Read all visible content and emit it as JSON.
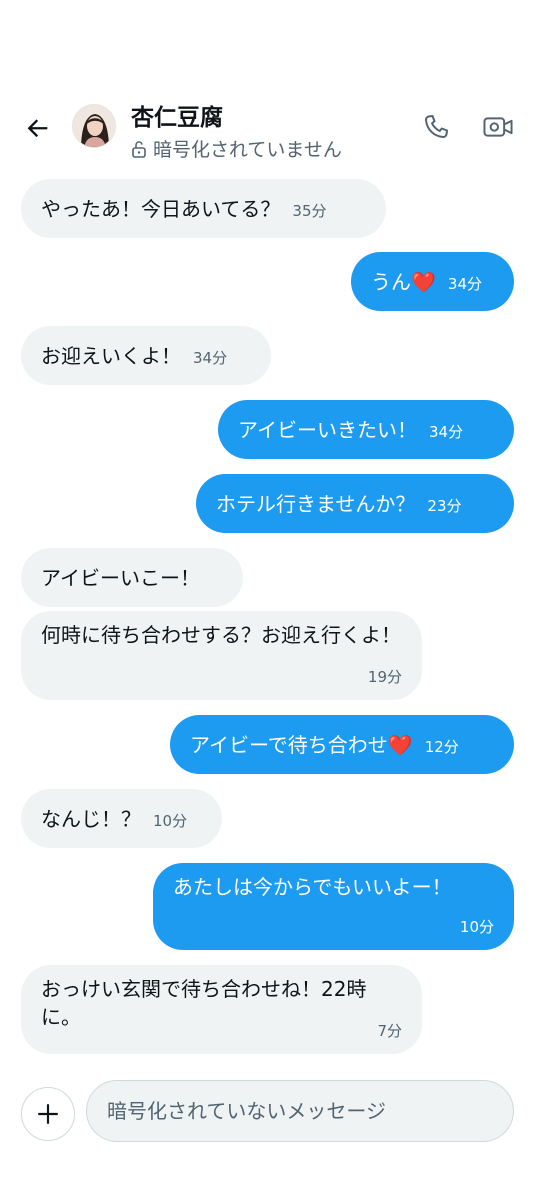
{
  "header": {
    "contact_name": "杏仁豆腐",
    "encryption_status": "暗号化されていません"
  },
  "messages": [
    {
      "dir": "in",
      "text": "やったあ！今日あいてる？",
      "time": "35分"
    },
    {
      "dir": "out",
      "text": "うん❤️",
      "time": "34分"
    },
    {
      "dir": "in",
      "text": "お迎えいくよ！",
      "time": "34分"
    },
    {
      "dir": "out",
      "text": "アイビーいきたい！",
      "time": "34分"
    },
    {
      "dir": "out",
      "text": "ホテル行きませんか？",
      "time": "23分"
    },
    {
      "dir": "in",
      "text": "アイビーいこー！",
      "time": ""
    },
    {
      "dir": "in",
      "text": "何時に待ち合わせする？お迎え行くよ！",
      "time": "19分"
    },
    {
      "dir": "out",
      "text": "アイビーで待ち合わせ❤️",
      "time": "12分"
    },
    {
      "dir": "in",
      "text": "なんじ！？",
      "time": "10分"
    },
    {
      "dir": "out",
      "text": "あたしは今からでもいいよー！",
      "time": "10分"
    },
    {
      "dir": "in",
      "text": "おっけい玄関で待ち合わせね！22時に。",
      "time": "7分"
    }
  ],
  "composer": {
    "placeholder": "暗号化されていないメッセージ"
  },
  "icons": {
    "back": "arrow-left-icon",
    "lock": "unlock-icon",
    "call": "phone-icon",
    "video": "video-icon",
    "add": "plus-icon"
  },
  "colors": {
    "outgoing_bubble": "#1d9bf0",
    "incoming_bubble": "#eff3f4",
    "secondary_text": "#536471"
  }
}
